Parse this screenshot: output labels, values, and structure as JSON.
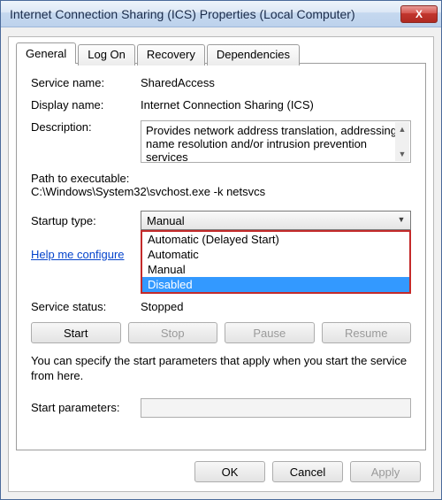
{
  "window": {
    "title": "Internet Connection Sharing (ICS) Properties (Local Computer)",
    "close_glyph": "X"
  },
  "tabs": {
    "general": "General",
    "logon": "Log On",
    "recovery": "Recovery",
    "dependencies": "Dependencies"
  },
  "labels": {
    "service_name": "Service name:",
    "display_name": "Display name:",
    "description": "Description:",
    "path": "Path to executable:",
    "startup_type": "Startup type:",
    "service_status": "Service status:",
    "start_parameters": "Start parameters:"
  },
  "values": {
    "service_name": "SharedAccess",
    "display_name": "Internet Connection Sharing (ICS)",
    "description": "Provides network address translation, addressing, name resolution and/or intrusion prevention services",
    "path": "C:\\Windows\\System32\\svchost.exe -k netsvcs",
    "startup_selected": "Manual",
    "service_status": "Stopped"
  },
  "startup_options": {
    "o0": "Automatic (Delayed Start)",
    "o1": "Automatic",
    "o2": "Manual",
    "o3": "Disabled"
  },
  "help_link": "Help me configure",
  "buttons": {
    "start": "Start",
    "stop": "Stop",
    "pause": "Pause",
    "resume": "Resume"
  },
  "note": "You can specify the start parameters that apply when you start the service from here.",
  "footer": {
    "ok": "OK",
    "cancel": "Cancel",
    "apply": "Apply"
  }
}
